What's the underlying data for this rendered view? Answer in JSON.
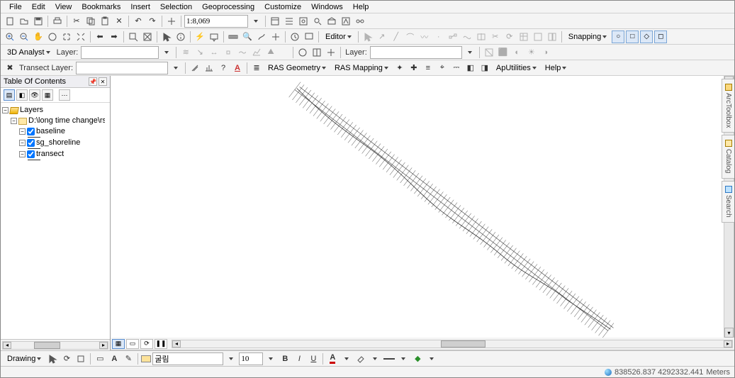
{
  "menu": [
    "File",
    "Edit",
    "View",
    "Bookmarks",
    "Insert",
    "Selection",
    "Geoprocessing",
    "Customize",
    "Windows",
    "Help"
  ],
  "scale": "1:8,069",
  "toolbar3": {
    "label1": "3D Analyst",
    "layer_label": "Layer:"
  },
  "toolsRow": {
    "layer_label": "Layer:",
    "editor": "Editor",
    "snapping": "Snapping"
  },
  "rasRow": {
    "transect": "Transect Layer:",
    "rasgeom": "RAS Geometry",
    "rasmap": "RAS Mapping",
    "aputil": "ApUtilities",
    "help": "Help"
  },
  "toc": {
    "title": "Table Of Contents",
    "root": "Layers",
    "folder": "D:\\long time change\\rs\\",
    "layers": [
      {
        "name": "baseline",
        "checked": true
      },
      {
        "name": "sg_shoreline",
        "checked": true
      },
      {
        "name": "transect",
        "checked": true
      }
    ]
  },
  "sidetabs": [
    "ArcToolbox",
    "Catalog",
    "Search"
  ],
  "drawbar": {
    "drawing": "Drawing",
    "font": "굴림",
    "size": "10"
  },
  "status": {
    "coords": "838526.837  4292332.441",
    "units": "Meters"
  }
}
